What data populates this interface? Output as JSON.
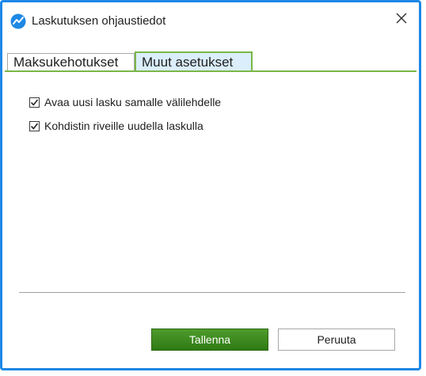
{
  "window": {
    "title": "Laskutuksen ohjaustiedot",
    "app_icon": "chart-line-icon",
    "close_icon": "close-icon",
    "border_color": "#1e88e5"
  },
  "tabs": [
    {
      "label": "Maksukehotukset",
      "active": false
    },
    {
      "label": "Muut asetukset",
      "active": true
    }
  ],
  "settings": [
    {
      "label": "Avaa uusi lasku samalle välilehdelle",
      "checked": true
    },
    {
      "label": "Kohdistin riveille uudella laskulla",
      "checked": true
    }
  ],
  "footer": {
    "save_label": "Tallenna",
    "cancel_label": "Peruuta",
    "accent": "#3d8a1f"
  }
}
